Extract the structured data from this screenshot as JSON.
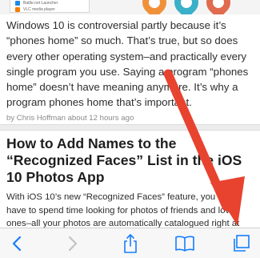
{
  "top_strip": {
    "items": [
      {
        "label": "Battle.net Launcher",
        "color": "#1e88e5"
      },
      {
        "label": "VLC media player",
        "color": "#f57c00"
      }
    ]
  },
  "article1": {
    "body": "Windows 10 is controversial partly because it’s “phones home” so much. That’s true, but so does every other operating system–and practically every single program you use. Saying a program “phones home” doesn’t have meaning anymore. It’s why a program phones home that’s important.",
    "byline": "by Chris Hoffman about 12 hours ago"
  },
  "article2": {
    "headline": "How to Add Names to the “Recognized Faces” List in the iOS 10 Photos App",
    "intro": "With iOS 10’s new “Recognized Faces” feature, you never have to spend time looking for photos of friends and loved ones–all your photos are automatically catalogued right at your fingertips."
  },
  "annotation": {
    "arrow_color": "#e8432f"
  },
  "toolbar": {
    "back": "back-chevron-icon",
    "forward": "forward-chevron-icon",
    "share": "share-icon",
    "bookmarks": "bookmarks-icon",
    "tabs": "tabs-icon",
    "tint": "#157efb",
    "disabled": "#c2c2c6"
  }
}
